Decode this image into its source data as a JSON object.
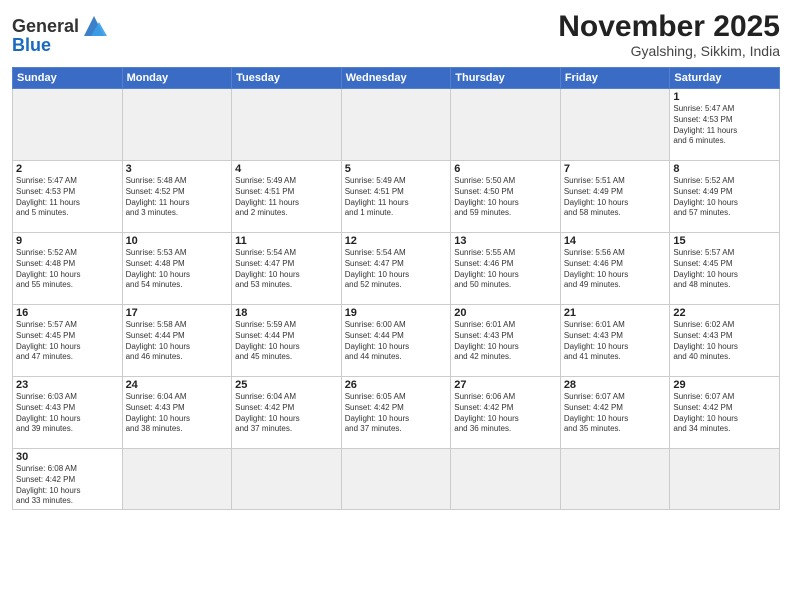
{
  "logo": {
    "text_general": "General",
    "text_blue": "Blue"
  },
  "title": {
    "month_year": "November 2025",
    "location": "Gyalshing, Sikkim, India"
  },
  "weekdays": [
    "Sunday",
    "Monday",
    "Tuesday",
    "Wednesday",
    "Thursday",
    "Friday",
    "Saturday"
  ],
  "weeks": [
    [
      {
        "day": "",
        "info": "",
        "empty": true
      },
      {
        "day": "",
        "info": "",
        "empty": true
      },
      {
        "day": "",
        "info": "",
        "empty": true
      },
      {
        "day": "",
        "info": "",
        "empty": true
      },
      {
        "day": "",
        "info": "",
        "empty": true
      },
      {
        "day": "",
        "info": "",
        "empty": true
      },
      {
        "day": "1",
        "info": "Sunrise: 5:47 AM\nSunset: 4:53 PM\nDaylight: 11 hours\nand 6 minutes."
      }
    ],
    [
      {
        "day": "2",
        "info": "Sunrise: 5:47 AM\nSunset: 4:53 PM\nDaylight: 11 hours\nand 5 minutes."
      },
      {
        "day": "3",
        "info": "Sunrise: 5:48 AM\nSunset: 4:52 PM\nDaylight: 11 hours\nand 3 minutes."
      },
      {
        "day": "4",
        "info": "Sunrise: 5:49 AM\nSunset: 4:51 PM\nDaylight: 11 hours\nand 2 minutes."
      },
      {
        "day": "5",
        "info": "Sunrise: 5:49 AM\nSunset: 4:51 PM\nDaylight: 11 hours\nand 1 minute."
      },
      {
        "day": "6",
        "info": "Sunrise: 5:50 AM\nSunset: 4:50 PM\nDaylight: 10 hours\nand 59 minutes."
      },
      {
        "day": "7",
        "info": "Sunrise: 5:51 AM\nSunset: 4:49 PM\nDaylight: 10 hours\nand 58 minutes."
      },
      {
        "day": "8",
        "info": "Sunrise: 5:52 AM\nSunset: 4:49 PM\nDaylight: 10 hours\nand 57 minutes."
      }
    ],
    [
      {
        "day": "9",
        "info": "Sunrise: 5:52 AM\nSunset: 4:48 PM\nDaylight: 10 hours\nand 55 minutes."
      },
      {
        "day": "10",
        "info": "Sunrise: 5:53 AM\nSunset: 4:48 PM\nDaylight: 10 hours\nand 54 minutes."
      },
      {
        "day": "11",
        "info": "Sunrise: 5:54 AM\nSunset: 4:47 PM\nDaylight: 10 hours\nand 53 minutes."
      },
      {
        "day": "12",
        "info": "Sunrise: 5:54 AM\nSunset: 4:47 PM\nDaylight: 10 hours\nand 52 minutes."
      },
      {
        "day": "13",
        "info": "Sunrise: 5:55 AM\nSunset: 4:46 PM\nDaylight: 10 hours\nand 50 minutes."
      },
      {
        "day": "14",
        "info": "Sunrise: 5:56 AM\nSunset: 4:46 PM\nDaylight: 10 hours\nand 49 minutes."
      },
      {
        "day": "15",
        "info": "Sunrise: 5:57 AM\nSunset: 4:45 PM\nDaylight: 10 hours\nand 48 minutes."
      }
    ],
    [
      {
        "day": "16",
        "info": "Sunrise: 5:57 AM\nSunset: 4:45 PM\nDaylight: 10 hours\nand 47 minutes."
      },
      {
        "day": "17",
        "info": "Sunrise: 5:58 AM\nSunset: 4:44 PM\nDaylight: 10 hours\nand 46 minutes."
      },
      {
        "day": "18",
        "info": "Sunrise: 5:59 AM\nSunset: 4:44 PM\nDaylight: 10 hours\nand 45 minutes."
      },
      {
        "day": "19",
        "info": "Sunrise: 6:00 AM\nSunset: 4:44 PM\nDaylight: 10 hours\nand 44 minutes."
      },
      {
        "day": "20",
        "info": "Sunrise: 6:01 AM\nSunset: 4:43 PM\nDaylight: 10 hours\nand 42 minutes."
      },
      {
        "day": "21",
        "info": "Sunrise: 6:01 AM\nSunset: 4:43 PM\nDaylight: 10 hours\nand 41 minutes."
      },
      {
        "day": "22",
        "info": "Sunrise: 6:02 AM\nSunset: 4:43 PM\nDaylight: 10 hours\nand 40 minutes."
      }
    ],
    [
      {
        "day": "23",
        "info": "Sunrise: 6:03 AM\nSunset: 4:43 PM\nDaylight: 10 hours\nand 39 minutes."
      },
      {
        "day": "24",
        "info": "Sunrise: 6:04 AM\nSunset: 4:43 PM\nDaylight: 10 hours\nand 38 minutes."
      },
      {
        "day": "25",
        "info": "Sunrise: 6:04 AM\nSunset: 4:42 PM\nDaylight: 10 hours\nand 37 minutes."
      },
      {
        "day": "26",
        "info": "Sunrise: 6:05 AM\nSunset: 4:42 PM\nDaylight: 10 hours\nand 37 minutes."
      },
      {
        "day": "27",
        "info": "Sunrise: 6:06 AM\nSunset: 4:42 PM\nDaylight: 10 hours\nand 36 minutes."
      },
      {
        "day": "28",
        "info": "Sunrise: 6:07 AM\nSunset: 4:42 PM\nDaylight: 10 hours\nand 35 minutes."
      },
      {
        "day": "29",
        "info": "Sunrise: 6:07 AM\nSunset: 4:42 PM\nDaylight: 10 hours\nand 34 minutes."
      }
    ],
    [
      {
        "day": "30",
        "info": "Sunrise: 6:08 AM\nSunset: 4:42 PM\nDaylight: 10 hours\nand 33 minutes.",
        "last": true
      },
      {
        "day": "",
        "info": "",
        "empty": true,
        "last": true
      },
      {
        "day": "",
        "info": "",
        "empty": true,
        "last": true
      },
      {
        "day": "",
        "info": "",
        "empty": true,
        "last": true
      },
      {
        "day": "",
        "info": "",
        "empty": true,
        "last": true
      },
      {
        "day": "",
        "info": "",
        "empty": true,
        "last": true
      },
      {
        "day": "",
        "info": "",
        "empty": true,
        "last": true
      }
    ]
  ]
}
